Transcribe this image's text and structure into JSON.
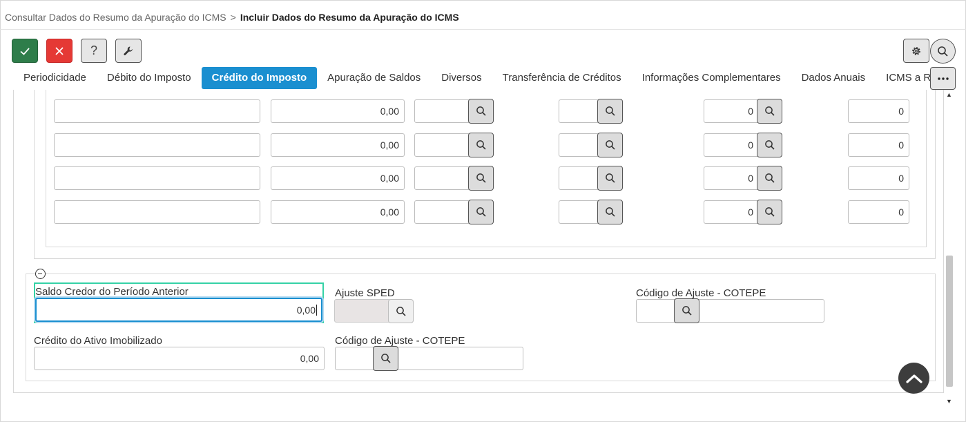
{
  "breadcrumb": {
    "parent": "Consultar Dados do Resumo da Apuração do ICMS",
    "separator": ">",
    "current": "Incluir Dados do Resumo da Apuração do ICMS"
  },
  "toolbar": {
    "confirm_icon": "check-icon",
    "cancel_icon": "close-icon",
    "help_label": "?",
    "tool_icon": "wrench-icon",
    "settings_icon": "gear-icon",
    "search_icon": "search-icon",
    "more_label": "···"
  },
  "tabs": [
    {
      "label": "Periodicidade",
      "active": false
    },
    {
      "label": "Débito do Imposto",
      "active": false
    },
    {
      "label": "Crédito do Imposto",
      "active": true
    },
    {
      "label": "Apuração de Saldos",
      "active": false
    },
    {
      "label": "Diversos",
      "active": false
    },
    {
      "label": "Transferência de Créditos",
      "active": false
    },
    {
      "label": "Informações Complementares",
      "active": false
    },
    {
      "label": "Dados Anuais",
      "active": false
    },
    {
      "label": "ICMS a Recolher",
      "active": false
    }
  ],
  "grid": {
    "rows": [
      {
        "col1": "",
        "amount": "0,00",
        "code_a": "",
        "code_b": "",
        "count": "0",
        "last": "0"
      },
      {
        "col1": "",
        "amount": "0,00",
        "code_a": "",
        "code_b": "",
        "count": "0",
        "last": "0"
      },
      {
        "col1": "",
        "amount": "0,00",
        "code_a": "",
        "code_b": "",
        "count": "0",
        "last": "0"
      },
      {
        "col1": "",
        "amount": "0,00",
        "code_a": "",
        "code_b": "",
        "count": "0",
        "last": "0"
      }
    ]
  },
  "form": {
    "saldo_credor_label": "Saldo Credor do Período Anterior",
    "saldo_credor_value": "0,00",
    "ajuste_sped_label": "Ajuste SPED",
    "ajuste_sped_value": "",
    "codigo_ajuste_label_1": "Código de Ajuste - COTEPE",
    "codigo_ajuste_value_1": "",
    "credito_ativo_label": "Crédito do Ativo Imobilizado",
    "credito_ativo_value": "0,00",
    "codigo_ajuste_label_2": "Código de Ajuste - COTEPE",
    "codigo_ajuste_value_2": ""
  },
  "colors": {
    "confirm": "#2e7d4a",
    "cancel": "#e53935",
    "active_tab": "#1a8fd0",
    "focus_outline": "#34d2a6"
  }
}
